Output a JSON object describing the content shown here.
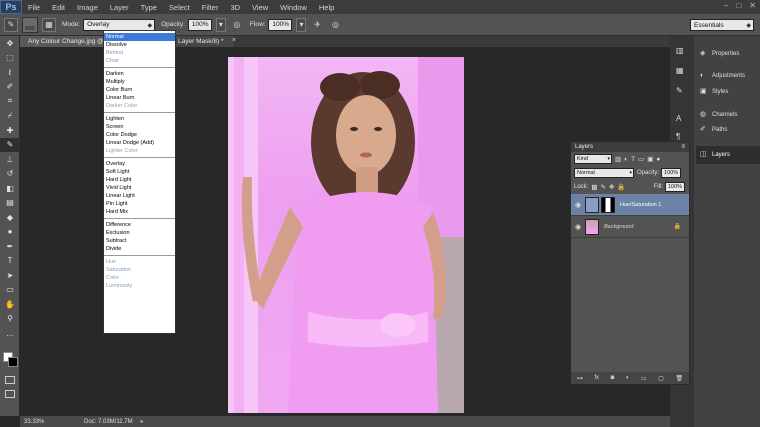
{
  "menubar": {
    "logo": "Ps",
    "items": [
      "File",
      "Edit",
      "Image",
      "Layer",
      "Type",
      "Select",
      "Filter",
      "3D",
      "View",
      "Window",
      "Help"
    ],
    "window_controls": [
      "–",
      "□",
      "✕"
    ]
  },
  "options": {
    "brush_size": "600",
    "mode_label": "Mode:",
    "mode_value": "Overlay",
    "opacity_label": "Opacity:",
    "opacity_value": "100%",
    "flow_label": "Flow:",
    "flow_value": "100%",
    "workspace": "Essentials"
  },
  "tabs": {
    "doc1": "Any Colour Change.jpg @",
    "doc2": "Layer Mask/8) *",
    "doc2_close": "×"
  },
  "blend_modes": [
    [
      {
        "label": "Normal",
        "state": "selected"
      },
      {
        "label": "Dissolve",
        "state": "normal"
      },
      {
        "label": "Behind",
        "state": "disabled"
      },
      {
        "label": "Clear",
        "state": "disabled"
      }
    ],
    [
      {
        "label": "Darken",
        "state": "normal"
      },
      {
        "label": "Multiply",
        "state": "normal"
      },
      {
        "label": "Color Burn",
        "state": "normal"
      },
      {
        "label": "Linear Burn",
        "state": "normal"
      },
      {
        "label": "Darker Color",
        "state": "disabled"
      }
    ],
    [
      {
        "label": "Lighten",
        "state": "normal"
      },
      {
        "label": "Screen",
        "state": "normal"
      },
      {
        "label": "Color Dodge",
        "state": "normal"
      },
      {
        "label": "Linear Dodge (Add)",
        "state": "normal"
      },
      {
        "label": "Lighter Color",
        "state": "disabled"
      }
    ],
    [
      {
        "label": "Overlay",
        "state": "normal"
      },
      {
        "label": "Soft Light",
        "state": "normal"
      },
      {
        "label": "Hard Light",
        "state": "normal"
      },
      {
        "label": "Vivid Light",
        "state": "normal"
      },
      {
        "label": "Linear Light",
        "state": "normal"
      },
      {
        "label": "Pin Light",
        "state": "normal"
      },
      {
        "label": "Hard Mix",
        "state": "normal"
      }
    ],
    [
      {
        "label": "Difference",
        "state": "normal"
      },
      {
        "label": "Exclusion",
        "state": "normal"
      },
      {
        "label": "Subtract",
        "state": "normal"
      },
      {
        "label": "Divide",
        "state": "normal"
      }
    ],
    [
      {
        "label": "Hue",
        "state": "disabled"
      },
      {
        "label": "Saturation",
        "state": "disabled"
      },
      {
        "label": "Color",
        "state": "disabled"
      },
      {
        "label": "Luminosity",
        "state": "disabled"
      }
    ]
  ],
  "dock": {
    "properties": "Properties",
    "adjustments": "Adjustments",
    "styles": "Styles",
    "channels": "Channels",
    "paths": "Paths",
    "layers": "Layers"
  },
  "layers_panel": {
    "title": "Layers",
    "kind": "Kind",
    "blend": "Normal",
    "opacity_label": "Opacity:",
    "opacity_value": "100%",
    "lock_label": "Lock:",
    "fill_label": "Fill:",
    "fill_value": "100%",
    "layers": [
      {
        "name": "Hue/Saturation 1",
        "active": true
      },
      {
        "name": "Background",
        "active": false
      }
    ]
  },
  "status": {
    "zoom": "33.33%",
    "doc": "Doc: 7.03M/11.7M"
  },
  "colors": {
    "foreground": "#ffffff",
    "background": "#000000",
    "photo_tint": "#f0a8f2"
  }
}
